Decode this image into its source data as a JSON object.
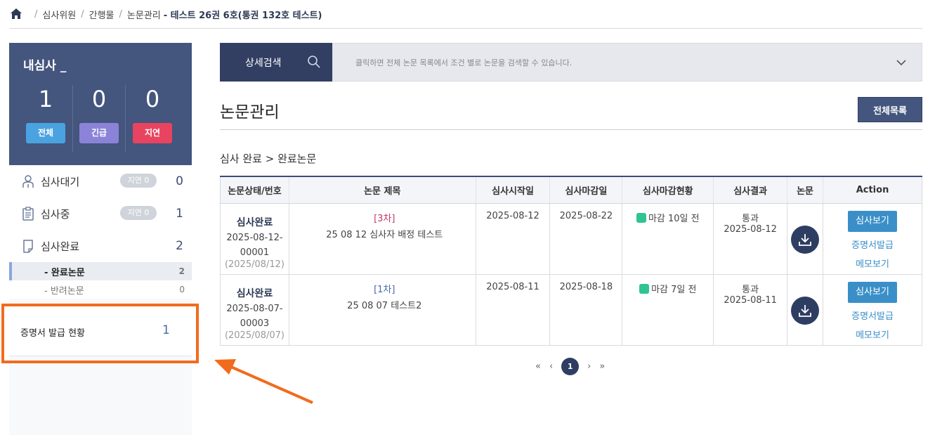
{
  "breadcrumb": {
    "items": [
      "심사위원",
      "간행물",
      "논문관리"
    ],
    "current": "- 테스트 26권 6호(통권 132호 테스트)"
  },
  "sidebar": {
    "my_title": "내심사 _",
    "stats": [
      {
        "num": "1",
        "label": "전체",
        "color": "#4aa3e0"
      },
      {
        "num": "0",
        "label": "긴급",
        "color": "#8b83d8"
      },
      {
        "num": "0",
        "label": "지연",
        "color": "#e8445f"
      }
    ],
    "menu": [
      {
        "label": "심사대기",
        "pill": "지연 0",
        "count": "0"
      },
      {
        "label": "심사중",
        "pill": "지연 0",
        "count": "1"
      },
      {
        "label": "심사완료",
        "count": "2"
      }
    ],
    "sub": [
      {
        "label": "- 완료논문",
        "count": "2"
      },
      {
        "label": "- 반려논문",
        "count": "0"
      }
    ],
    "cert": {
      "label": "증명서 발급 현황",
      "count": "1"
    }
  },
  "search": {
    "button": "상세검색",
    "placeholder": "클릭하면 전체 논문 목록에서 조건 별로 논문을 검색할 수 있습니다."
  },
  "main": {
    "title": "논문관리",
    "all_button": "전체목록",
    "section": "심사 완료 > 완료논문"
  },
  "table": {
    "headers": [
      "논문상태/번호",
      "논문 제목",
      "심사시작일",
      "심사마감일",
      "심사마감현황",
      "심사결과",
      "논문",
      "Action"
    ],
    "rows": [
      {
        "status": "심사완료",
        "no1": "2025-08-12-",
        "no2": "00001",
        "date": "(2025/08/12)",
        "round": "[3차]",
        "name": "25 08 12 심사자 배정 테스트",
        "start": "2025-08-12",
        "end": "2025-08-22",
        "deadline": "마감 10일 전",
        "result": "통과",
        "result_date": "2025-08-12",
        "btn": "심사보기",
        "link1": "증명서발급",
        "link2": "메모보기"
      },
      {
        "status": "심사완료",
        "no1": "2025-08-07-",
        "no2": "00003",
        "date": "(2025/08/07)",
        "round": "[1차]",
        "name": "25 08 07 테스트2",
        "start": "2025-08-11",
        "end": "2025-08-18",
        "deadline": "마감 7일 전",
        "result": "통과",
        "result_date": "2025-08-11",
        "btn": "심사보기",
        "link1": "증명서발급",
        "link2": "메모보기"
      }
    ]
  },
  "pager": {
    "first": "«",
    "prev": "‹",
    "current": "1",
    "next": "›",
    "last": "»"
  }
}
